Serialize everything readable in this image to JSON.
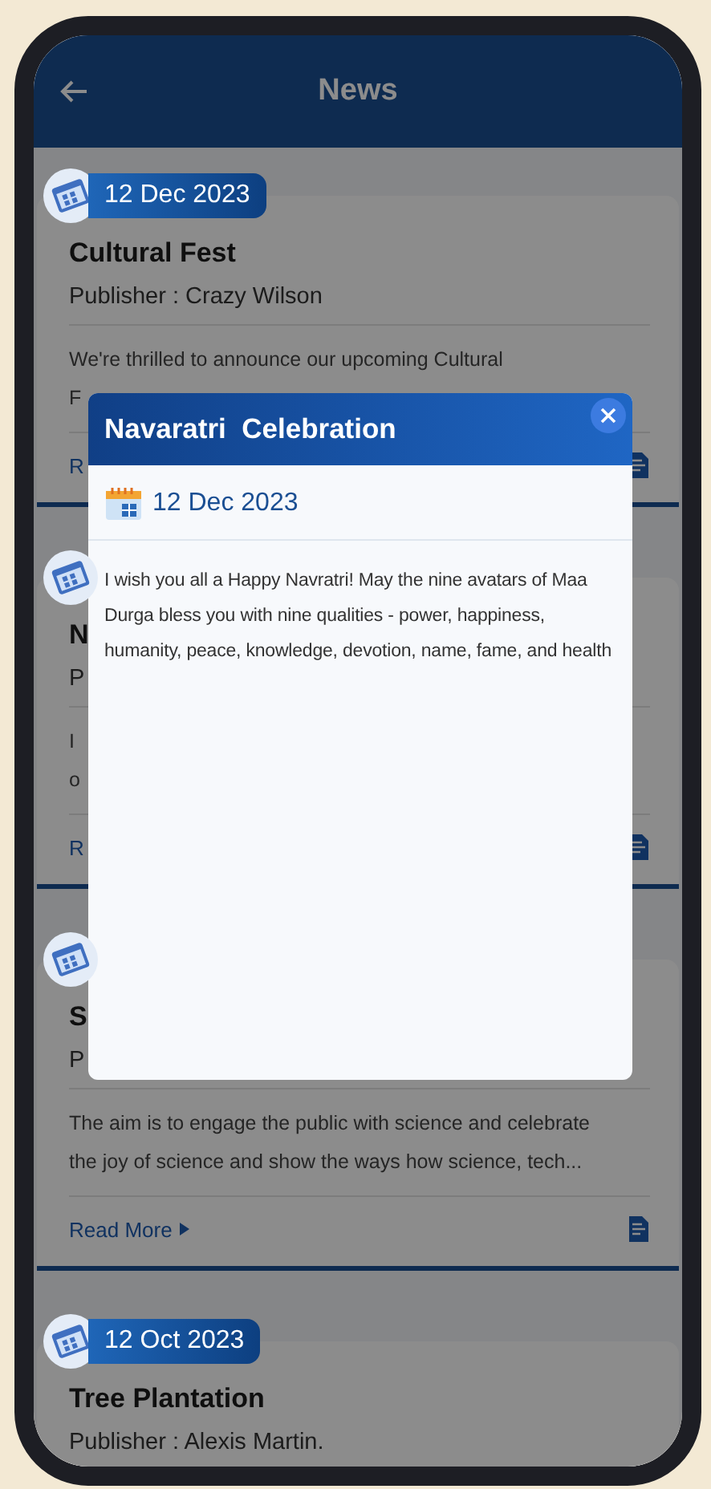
{
  "header": {
    "title": "News"
  },
  "cards": [
    {
      "date": "12 Dec 2023",
      "title": "Cultural Fest",
      "publisher": "Publisher : Crazy Wilson",
      "body_lines": [
        "We're thrilled to announce our upcoming Cultural",
        "F"
      ],
      "read_more": "R"
    },
    {
      "title": "N",
      "publisher": "P",
      "body_lines": [
        "I",
        "o"
      ],
      "read_more": "R"
    },
    {
      "title": "S",
      "publisher": "P",
      "body_lines": [
        "The aim is to engage the public with science and celebrate",
        "the joy of science and show the ways how science, tech..."
      ],
      "read_more": "Read More"
    },
    {
      "date": "12 Oct 2023",
      "title": "Tree Plantation",
      "publisher": "Publisher : Alexis Martin."
    }
  ],
  "dialog": {
    "title": "Navaratri  Celebration",
    "date": "12 Dec 2023",
    "message": "I wish you all a Happy Navratri! May the nine avatars of Maa Durga bless you with nine qualities - power, happiness, humanity, peace, knowledge, devotion, name, fame, and health"
  }
}
